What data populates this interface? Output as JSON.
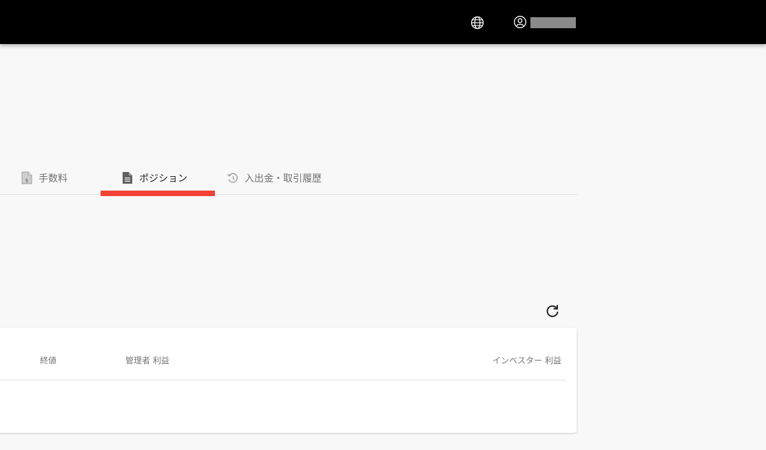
{
  "header": {
    "language_icon": "globe-icon",
    "account_icon": "account-circle-icon",
    "username": ""
  },
  "tabs": [
    {
      "label": "手数料",
      "icon": "fee-document-icon"
    },
    {
      "label": "ポジション",
      "icon": "document-icon",
      "active": true
    },
    {
      "label": "入出金・取引履歴",
      "icon": "history-icon"
    }
  ],
  "colors": {
    "topbar": "#000000",
    "accent": "#f44336",
    "background": "#f8f8f8"
  },
  "toolbar": {
    "refresh_icon": "refresh-icon"
  },
  "table": {
    "columns": [
      "終値",
      "管理者 利益",
      "インベスター 利益"
    ],
    "rows": []
  }
}
